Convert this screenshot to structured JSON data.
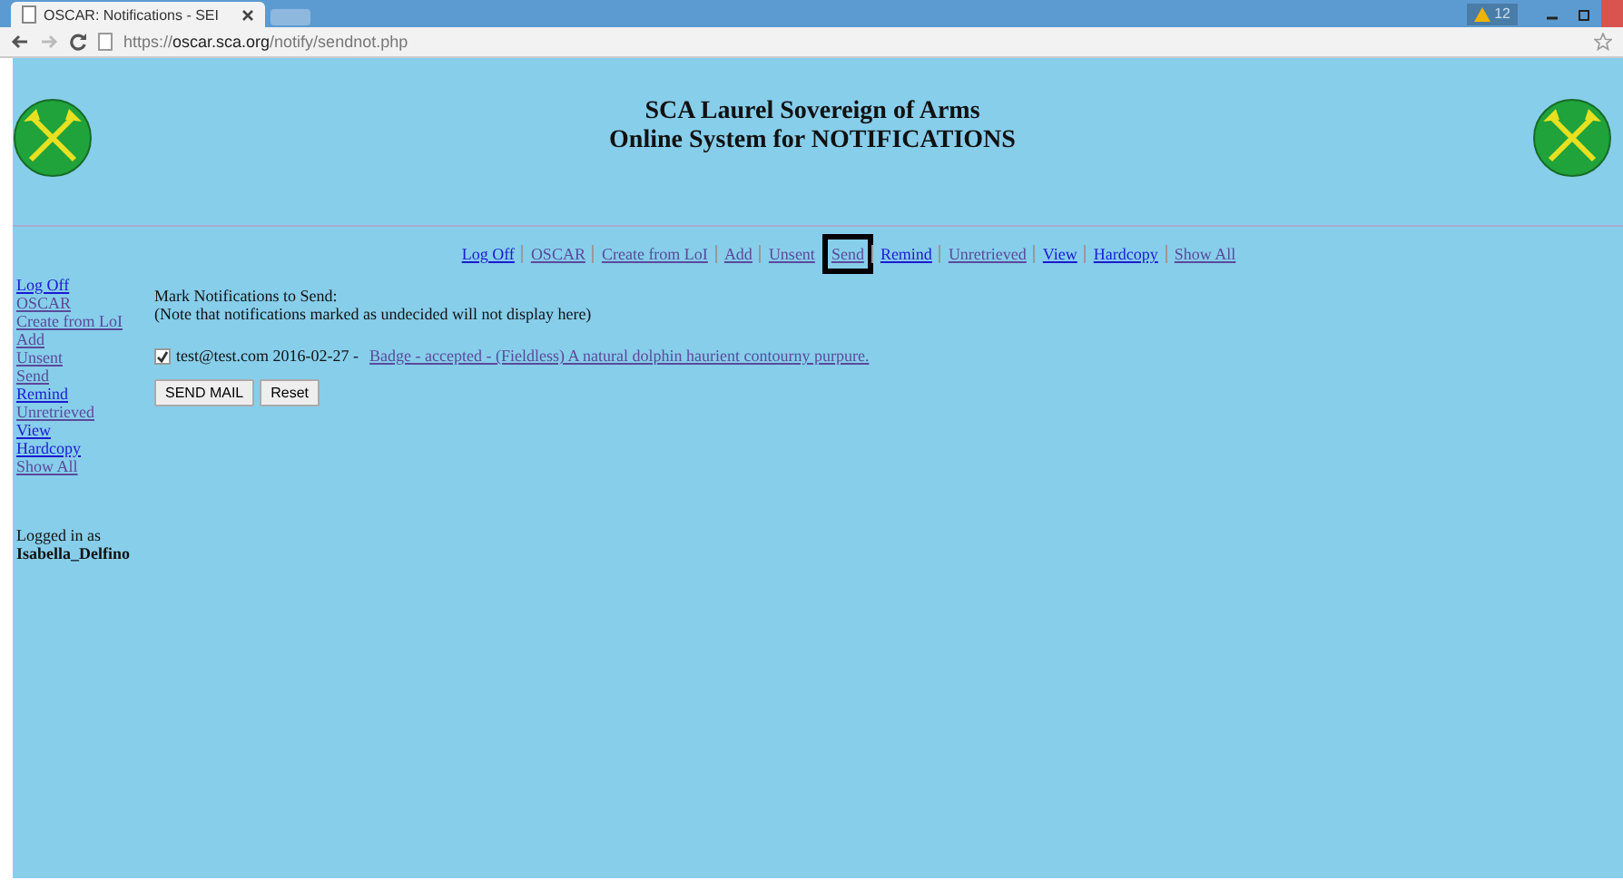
{
  "browser": {
    "tab_title": "OSCAR: Notifications - SEI",
    "alert_count": "12",
    "url_scheme": "https://",
    "url_host": "oscar.sca.org",
    "url_path": "/notify/sendnot.php"
  },
  "header": {
    "title_lines": [
      "SCA Laurel Sovereign of Arms",
      "Online System for NOTIFICATIONS"
    ]
  },
  "top_nav": [
    {
      "label": "Log Off",
      "visited": false,
      "highlighted": false
    },
    {
      "label": "OSCAR",
      "visited": true,
      "highlighted": false
    },
    {
      "label": "Create from LoI",
      "visited": true,
      "highlighted": false
    },
    {
      "label": "Add",
      "visited": true,
      "highlighted": false
    },
    {
      "label": "Unsent",
      "visited": true,
      "highlighted": false
    },
    {
      "label": "Send",
      "visited": true,
      "highlighted": true
    },
    {
      "label": "Remind",
      "visited": false,
      "highlighted": false
    },
    {
      "label": "Unretrieved",
      "visited": true,
      "highlighted": false
    },
    {
      "label": "View",
      "visited": false,
      "highlighted": false
    },
    {
      "label": "Hardcopy",
      "visited": false,
      "highlighted": false
    },
    {
      "label": "Show All",
      "visited": true,
      "highlighted": false
    }
  ],
  "sidebar": {
    "items": [
      {
        "label": "Log Off",
        "visited": false
      },
      {
        "label": "OSCAR",
        "visited": true
      },
      {
        "label": "Create from LoI",
        "visited": true
      },
      {
        "label": "Add",
        "visited": true
      },
      {
        "label": "Unsent",
        "visited": true
      },
      {
        "label": "Send",
        "visited": true
      },
      {
        "label": "Remind",
        "visited": false
      },
      {
        "label": "Unretrieved",
        "visited": true
      },
      {
        "label": "View",
        "visited": false
      },
      {
        "label": "Hardcopy",
        "visited": false
      },
      {
        "label": "Show All",
        "visited": true
      }
    ],
    "logged_in_label": "Logged in as",
    "user": "Isabella_Delfino"
  },
  "main": {
    "heading": "Mark Notifications to Send:",
    "note": "(Note that notifications marked as undecided will not display here)",
    "notifications": [
      {
        "checked": true,
        "text": "test@test.com 2016-02-27 -",
        "link": "Badge - accepted - (Fieldless) A natural dolphin haurient contourny purpure."
      }
    ],
    "buttons": [
      "SEND MAIL",
      "Reset"
    ]
  }
}
